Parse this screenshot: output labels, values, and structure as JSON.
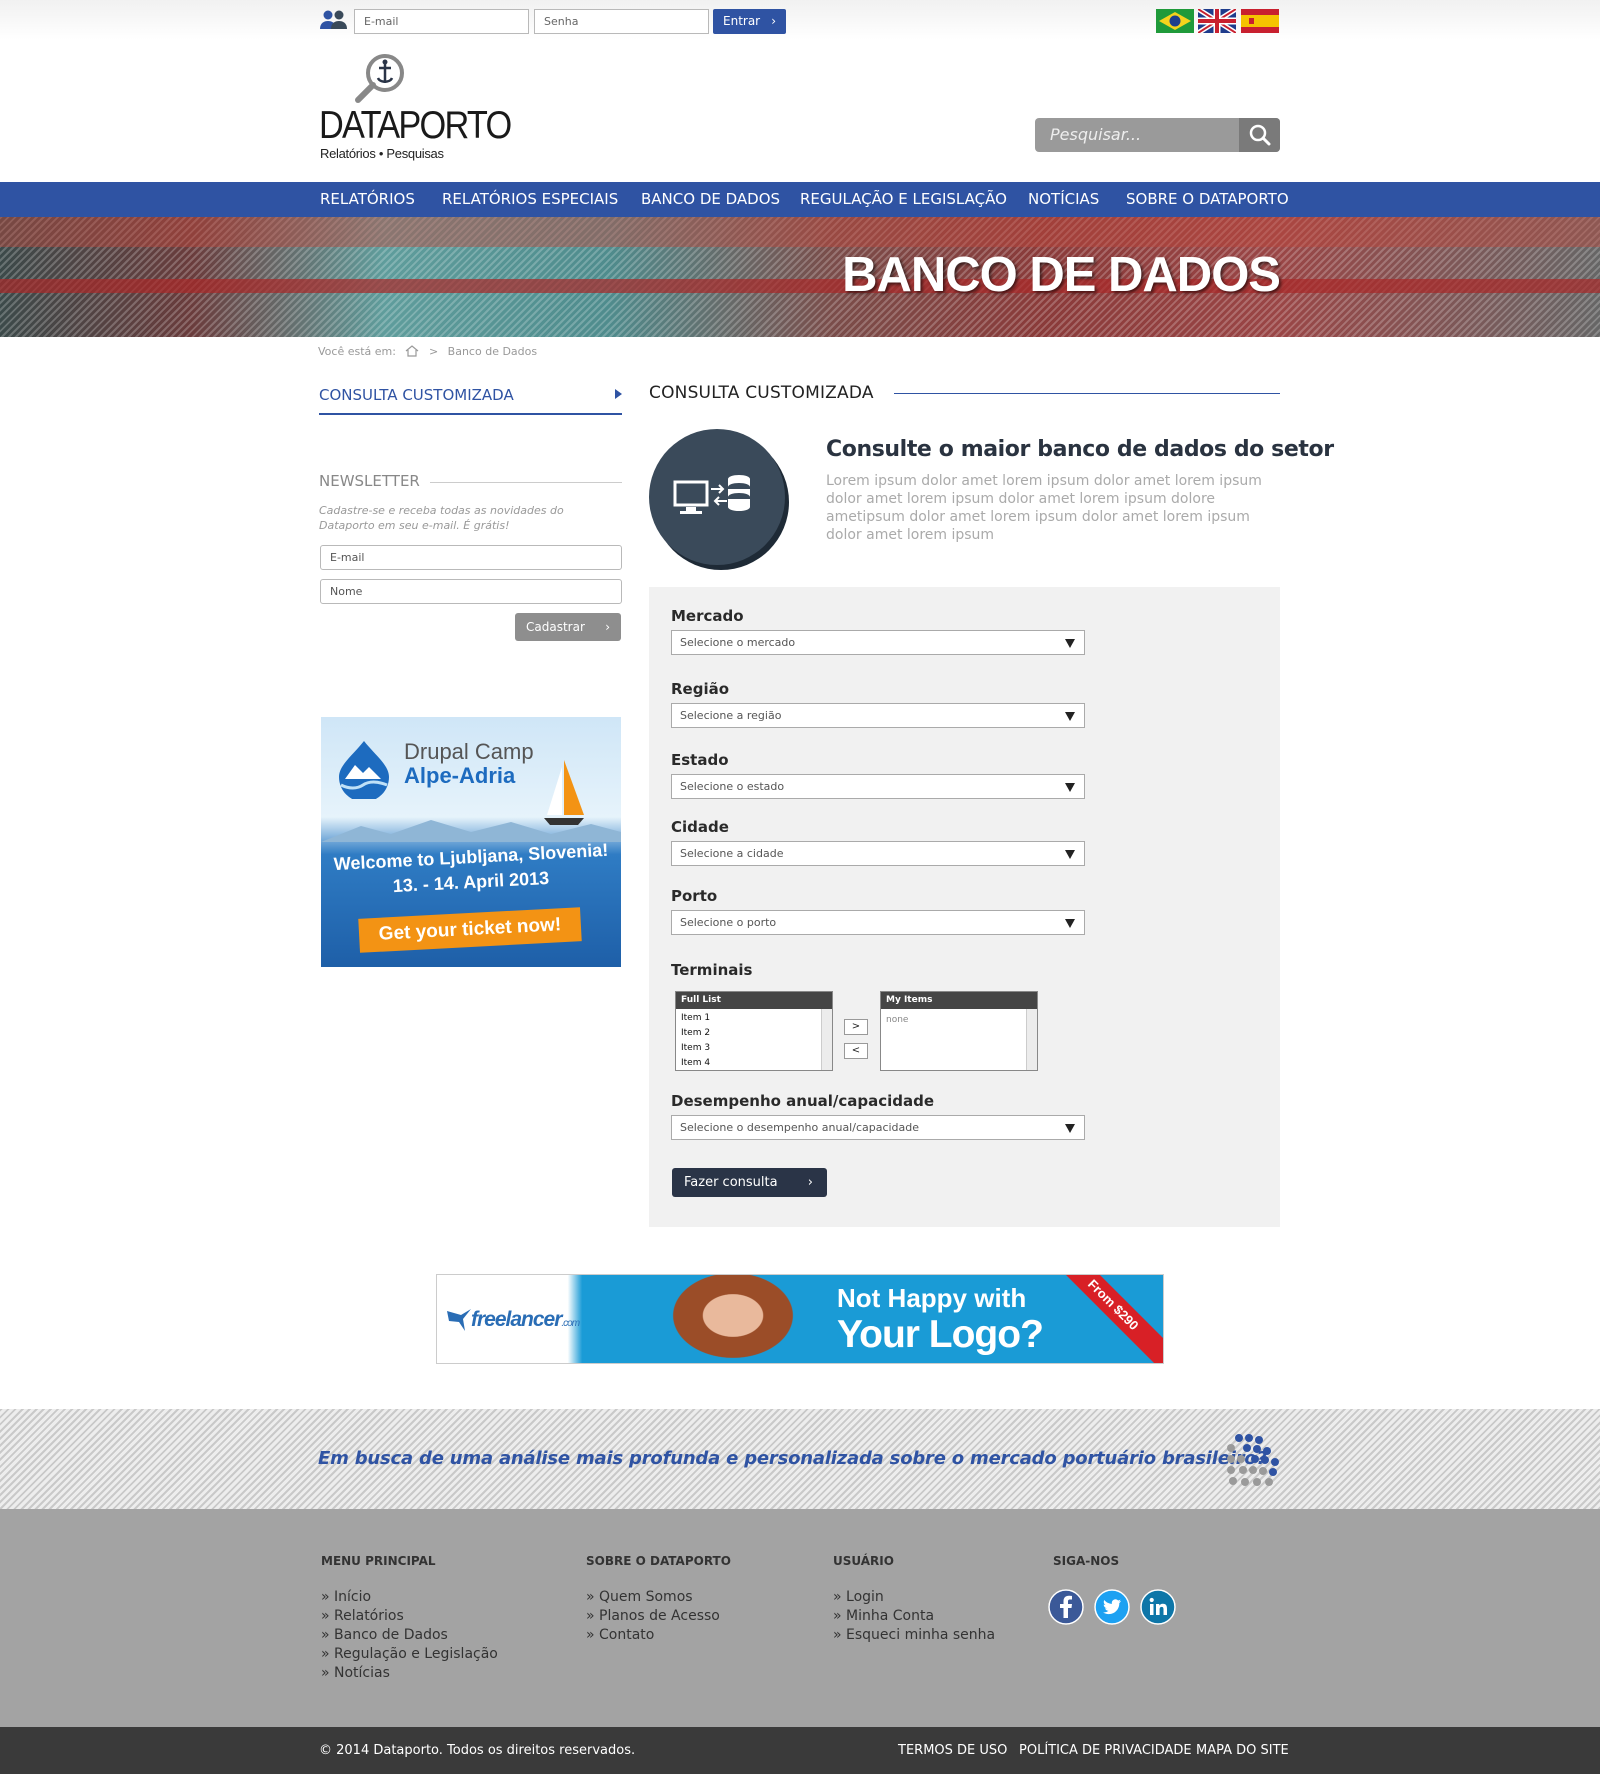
{
  "topbar": {
    "email_placeholder": "E-mail",
    "password_placeholder": "Senha",
    "login_label": "Entrar",
    "flags": [
      "Brasil",
      "United Kingdom",
      "España"
    ]
  },
  "header": {
    "logo_name": "DATAPORTO",
    "logo_tagline": "Relatórios • Pesquisas",
    "search_placeholder": "Pesquisar..."
  },
  "nav": {
    "items": [
      {
        "label": "RELATÓRIOS"
      },
      {
        "label": "RELATÓRIOS ESPECIAIS"
      },
      {
        "label": "BANCO DE DADOS"
      },
      {
        "label": "REGULAÇÃO E LEGISLAÇÃO"
      },
      {
        "label": "NOTÍCIAS"
      },
      {
        "label": "SOBRE O DATAPORTO"
      }
    ]
  },
  "hero": {
    "title": "BANCO DE DADOS"
  },
  "breadcrumb": {
    "prefix": "Você está em:",
    "separator": ">",
    "current": "Banco de Dados"
  },
  "sidebar": {
    "menu_item": "CONSULTA CUSTOMIZADA",
    "newsletter": {
      "title": "NEWSLETTER",
      "description": "Cadastre-se e receba todas as novidades do Dataporto em seu e-mail. É grátis!",
      "email_placeholder": "E-mail",
      "name_placeholder": "Nome",
      "submit_label": "Cadastrar"
    },
    "ad": {
      "title_line1": "Drupal Camp",
      "title_line2": "Alpe-Adria",
      "welcome": "Welcome to Ljubljana, Slovenia!",
      "date": "13. - 14. April 2013",
      "cta": "Get your ticket now!"
    }
  },
  "main": {
    "title": "CONSULTA CUSTOMIZADA",
    "intro_heading": "Consulte o maior banco de dados do setor",
    "intro_text": "Lorem ipsum dolor amet lorem ipsum dolor amet lorem ipsum dolor amet lorem ipsum dolor amet lorem ipsum dolore ametipsum dolor amet lorem ipsum dolor amet lorem ipsum dolor amet lorem ipsum",
    "form": {
      "mercado": {
        "label": "Mercado",
        "value": "Selecione o mercado"
      },
      "regiao": {
        "label": "Região",
        "value": "Selecione a região"
      },
      "estado": {
        "label": "Estado",
        "value": "Selecione o estado"
      },
      "cidade": {
        "label": "Cidade",
        "value": "Selecione a cidade"
      },
      "porto": {
        "label": "Porto",
        "value": "Selecione o porto"
      },
      "terminais": {
        "label": "Terminais",
        "full_list_header": "Full List",
        "full_list_items": [
          "Item 1",
          "Item 2",
          "Item 3",
          "Item 4"
        ],
        "my_items_header": "My Items",
        "my_items_empty": "none",
        "add_label": ">",
        "remove_label": "<"
      },
      "desempenho": {
        "label": "Desempenho anual/capacidade",
        "value": "Selecione o desempenho anual/capacidade"
      },
      "submit_label": "Fazer consulta"
    }
  },
  "banner_ad": {
    "logo": "freelancer",
    "logo_suffix": ".com",
    "line1": "Not Happy with",
    "line2": "Your Logo?",
    "ribbon": "From $290"
  },
  "tagline": {
    "text": "Em busca de uma análise mais profunda e personalizada sobre o mercado portuário brasileiro?"
  },
  "footer": {
    "columns": [
      {
        "title": "MENU PRINCIPAL",
        "links": [
          "» Início",
          "» Relatórios",
          "» Banco de Dados",
          "» Regulação e Legislação",
          "» Notícias"
        ]
      },
      {
        "title": "SOBRE O DATAPORTO",
        "links": [
          "» Quem Somos",
          "» Planos de Acesso",
          "» Contato"
        ]
      },
      {
        "title": "USUÁRIO",
        "links": [
          "» Login",
          "» Minha Conta",
          "» Esqueci minha senha"
        ]
      },
      {
        "title": "SIGA-NOS",
        "social": [
          "facebook-icon",
          "twitter-icon",
          "linkedin-icon"
        ]
      }
    ],
    "copyright": "© 2014 Dataporto. Todos os direitos reservados.",
    "bottom_links": [
      "TERMOS DE USO",
      "POLÍTICA DE PRIVACIDADE",
      "MAPA DO SITE"
    ]
  },
  "colors": {
    "primary_blue": "#2f53a3",
    "dark_navy": "#2a3447",
    "footer_gray": "#a3a3a3",
    "bottom_bar": "#3a3a3a",
    "ad_orange": "#f39314"
  }
}
